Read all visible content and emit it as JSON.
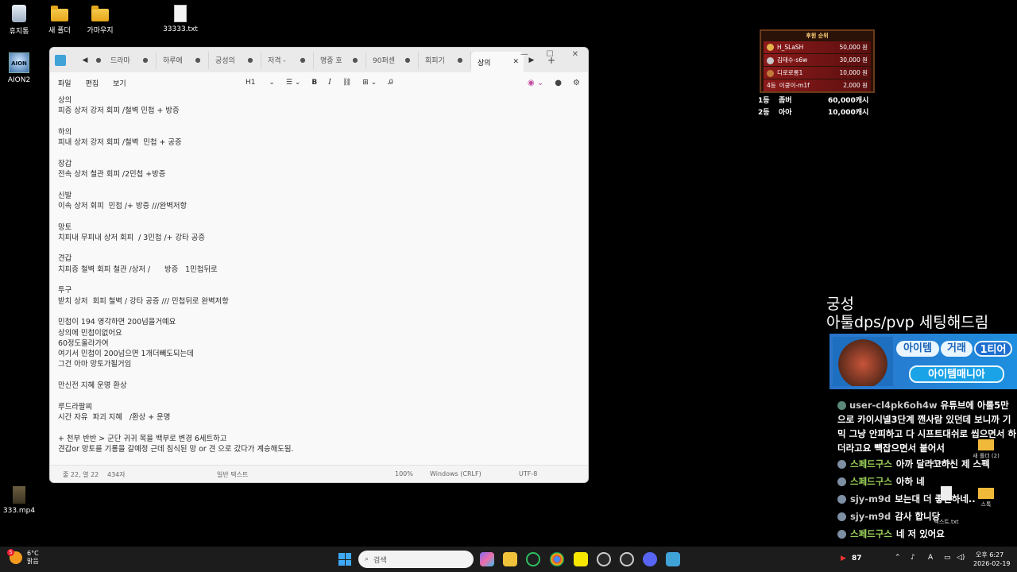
{
  "desktop_icons": [
    {
      "label": "휴지통",
      "icon": "recycle-bin-icon"
    },
    {
      "label": "새 폴더",
      "icon": "folder-icon"
    },
    {
      "label": "가마우지",
      "icon": "folder-icon"
    },
    {
      "label": "33333.txt",
      "icon": "text-file-icon"
    },
    {
      "label": "AION2",
      "icon": "aion2-app-icon"
    },
    {
      "label": "333.mp4",
      "icon": "video-file-icon"
    }
  ],
  "notepad": {
    "tabs": [
      "드라마",
      "하루에",
      "궁성의",
      "저격 -",
      "명중 호",
      "90퍼센",
      "회피기",
      "상의"
    ],
    "active_tab": "상의",
    "menu": [
      "파일",
      "편집",
      "보기"
    ],
    "toolbar": {
      "heading": "H1",
      "bold": "B",
      "italic": "I"
    },
    "lines": [
      "상의",
      "피증 상저 강저 회피 /철벽 민첩 + 방증",
      "",
      "하의",
      "피내 상저 강저 회피 /철벽  민첩 + 공증",
      "",
      "장갑",
      "전속 상저 철관 회피 /2민첩 +방증",
      "",
      "신발",
      "이속 상저 회피  민첩 /+ 방증 ///완벽저항",
      "",
      "망토",
      "치피내 무피내 상저 회피  / 3민첩 /+ 강타 공증",
      "",
      "견갑",
      "치피증 철벽 회피 철관 /상저 /      방증   1민첩뒤로",
      "",
      "투구",
      "받치 상저  회피 철벽 / 강타 공증 /// 민첩뒤로 완벽저항",
      "",
      "민첩이 194 영각하면 200넘을거예요",
      "상의에 민첩이없어요",
      "60정도올라가여",
      "여기서 민첩이 200넘으면 1개더빼도되는데",
      "그건 아마 망토가될거임",
      "",
      "만신전 지혜 운명 환상",
      "",
      "루드라팔찌",
      "시간 자유  파괴 지혜   /환상 + 운명",
      "",
      "+ 천부 반반 > 군단 귀귀 목을 백부로 변경 6세트하고",
      "견갑or 망토를 기룡을 갈예정 근데 침식된 망 or 견 으로 갔다가 계승해도됨."
    ],
    "status": {
      "position": "줄 22, 열 22",
      "chars": "434자",
      "format": "일반 텍스트",
      "zoom": "100%",
      "line_ending": "Windows (CRLF)",
      "encoding": "UTF-8"
    }
  },
  "donation": {
    "title": "후원 순위",
    "rows": [
      {
        "name": "H_SLaSH",
        "amount": "50,000 원"
      },
      {
        "name": "김태수-s6w",
        "amount": "30,000 원"
      },
      {
        "name": "디로로롱1",
        "amount": "10,000 원"
      },
      {
        "name": "이쿵이-m1f",
        "amount": "2,000 원",
        "rank": "4등"
      }
    ],
    "ranks": [
      {
        "rank": "1등",
        "name": "좀버",
        "amount": "60,000캐시"
      },
      {
        "rank": "2등",
        "name": "아아",
        "amount": "10,000캐시"
      }
    ]
  },
  "overlay": {
    "line1": "궁성",
    "line2": "아툴dps/pvp 세팅해드림",
    "banner_pills": [
      "아이템",
      "거래",
      "1티어",
      "아이템매니아"
    ]
  },
  "chat": [
    {
      "nick": "user-cl4pk6oh4w",
      "msg": "유튜브에 아룰5만으로 카이시넬3단계 깬사람 있던데 보니까 기믹 그냥 안피하고 다 시프트대쉬로 씹으면서 하더라고요 뺵잡으면서 붙어서",
      "color": "grey"
    },
    {
      "nick": "스페드구스",
      "msg": "아까 달라고하신 제 스펙",
      "color": "green"
    },
    {
      "nick": "스페드구스",
      "msg": "아하 네",
      "color": "green"
    },
    {
      "nick": "sjy-m9d",
      "msg": "보는대 더 좋긴하네..",
      "color": "grey"
    },
    {
      "nick": "sjy-m9d",
      "msg": "감사 합니당",
      "color": "grey"
    },
    {
      "nick": "스페드구스",
      "msg": "네 저 있어요",
      "color": "green"
    }
  ],
  "right_icons": [
    "KakaoTalk",
    "새 폴더 (2)",
    "스톡",
    "텍스트.txt"
  ],
  "taskbar": {
    "weather_temp": "6°C",
    "weather_desc": "맑음",
    "weather_badge": "5",
    "search_placeholder": "검색",
    "viewers": "87",
    "ime": "A",
    "time": "오후 6:27",
    "date": "2026-02-19"
  }
}
